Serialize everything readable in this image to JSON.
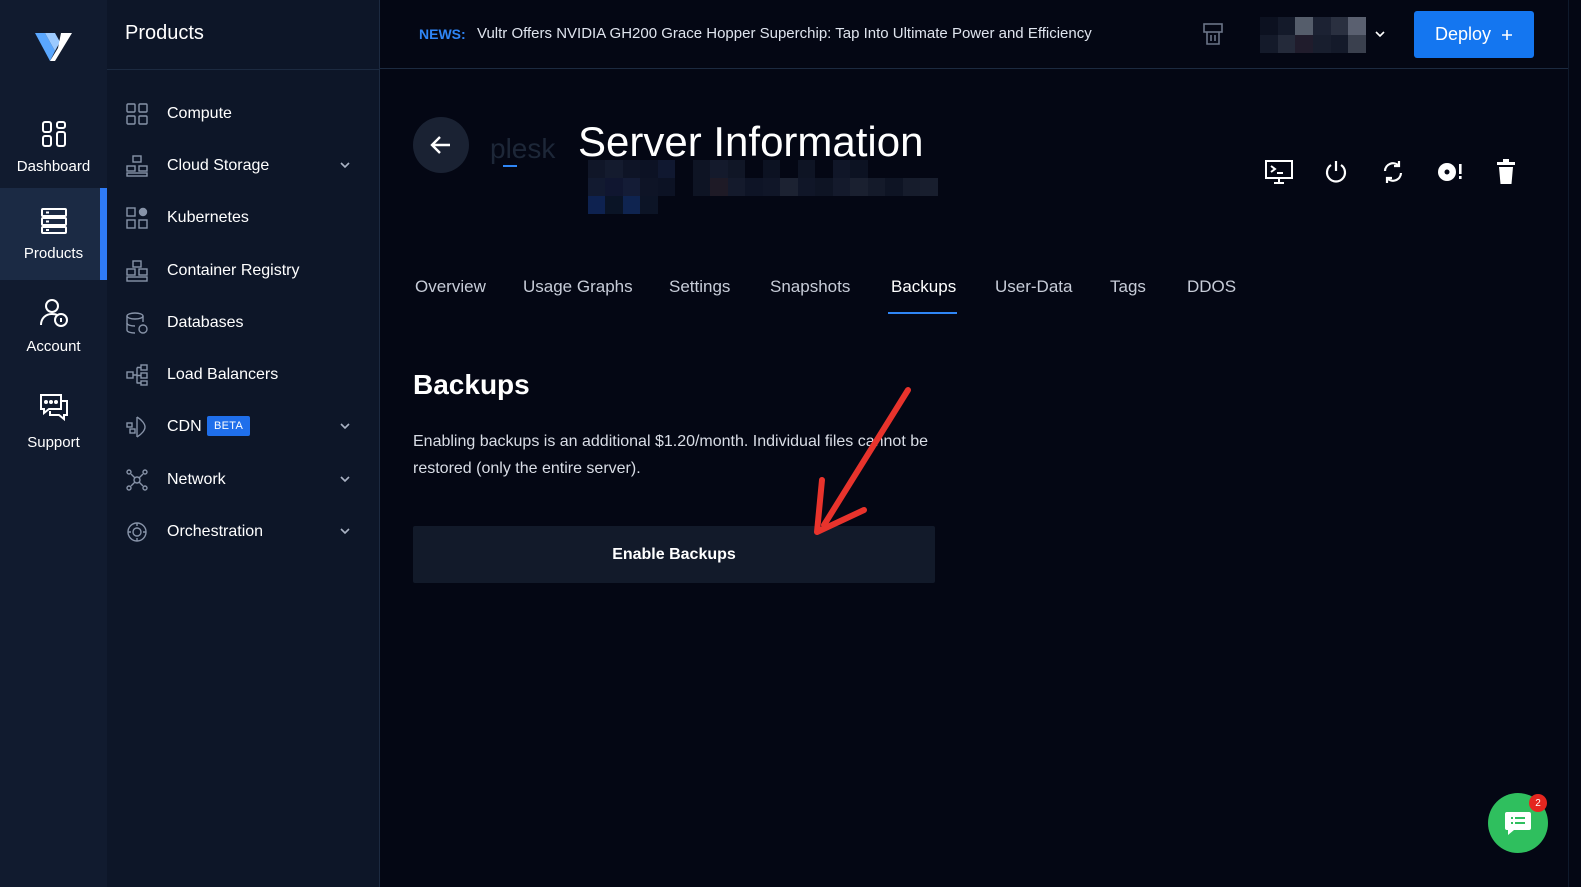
{
  "rail": {
    "items": [
      {
        "label": "Dashboard",
        "icon": "grid-icon"
      },
      {
        "label": "Products",
        "icon": "server-stack-icon",
        "active": true
      },
      {
        "label": "Account",
        "icon": "user-lock-icon"
      },
      {
        "label": "Support",
        "icon": "chat-bubbles-icon"
      }
    ]
  },
  "panel": {
    "title": "Products",
    "items": [
      {
        "label": "Compute",
        "icon": "compute-icon",
        "expandable": false
      },
      {
        "label": "Cloud Storage",
        "icon": "cloud-storage-icon",
        "expandable": true
      },
      {
        "label": "Kubernetes",
        "icon": "kubernetes-icon",
        "expandable": false
      },
      {
        "label": "Container Registry",
        "icon": "container-registry-icon",
        "expandable": false
      },
      {
        "label": "Databases",
        "icon": "database-icon",
        "expandable": false
      },
      {
        "label": "Load Balancers",
        "icon": "load-balancer-icon",
        "expandable": false
      },
      {
        "label": "CDN",
        "icon": "cdn-icon",
        "expandable": true,
        "badge": "BETA"
      },
      {
        "label": "Network",
        "icon": "network-icon",
        "expandable": true
      },
      {
        "label": "Orchestration",
        "icon": "orchestration-icon",
        "expandable": true
      }
    ]
  },
  "topbar": {
    "news_tag": "NEWS:",
    "news_text": "Vultr Offers NVIDIA GH200 Grace Hopper Superchip: Tap Into Ultimate Power and Efficiency",
    "deploy_label": "Deploy",
    "deploy_icon": "plus-icon"
  },
  "server": {
    "label": "plesk",
    "title": "Server Information",
    "actions": [
      "console-icon",
      "power-icon",
      "restart-icon",
      "reinstall-icon",
      "trash-icon"
    ]
  },
  "tabs": [
    {
      "label": "Overview"
    },
    {
      "label": "Usage Graphs"
    },
    {
      "label": "Settings"
    },
    {
      "label": "Snapshots"
    },
    {
      "label": "Backups",
      "active": true
    },
    {
      "label": "User-Data"
    },
    {
      "label": "Tags"
    },
    {
      "label": "DDOS"
    }
  ],
  "backups": {
    "title": "Backups",
    "description": "Enabling backups is an additional $1.20/month. Individual files cannot be restored (only the entire server).",
    "button_label": "Enable Backups"
  },
  "chat": {
    "badge": "2"
  },
  "colors": {
    "accent": "#1476f0",
    "background": "#040714",
    "chat": "#2fbf5e",
    "annotation_arrow": "#e8332c"
  }
}
